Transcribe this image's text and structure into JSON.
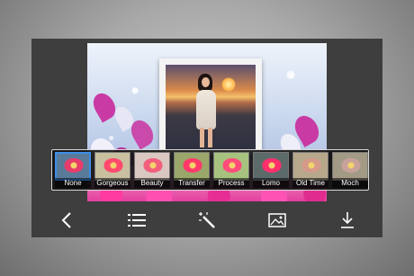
{
  "filters": [
    {
      "label": "None",
      "selected": true,
      "tint": "#5a7a9a",
      "petal": "#e83c6a"
    },
    {
      "label": "Gorgeous",
      "selected": false,
      "tint": "#c9c0a0",
      "petal": "#ff4a6e"
    },
    {
      "label": "Beauty",
      "selected": false,
      "tint": "#d9c7c2",
      "petal": "#f25f7c"
    },
    {
      "label": "Transfer",
      "selected": false,
      "tint": "#9aa76a",
      "petal": "#ff3a6a"
    },
    {
      "label": "Process",
      "selected": false,
      "tint": "#a7c27f",
      "petal": "#ff4c7a"
    },
    {
      "label": "Lomo",
      "selected": false,
      "tint": "#5d6a6a",
      "petal": "#ff2f6c"
    },
    {
      "label": "Old Time",
      "selected": false,
      "tint": "#b7a88c",
      "petal": "#d59a8a"
    },
    {
      "label": "Moch",
      "selected": false,
      "tint": "#a39a85",
      "petal": "#c8a29a"
    }
  ],
  "toolbar": {
    "back_icon": "chevron-left-icon",
    "menu_icon": "list-icon",
    "effects_icon": "magic-wand-icon",
    "gallery_icon": "image-icon",
    "download_icon": "download-icon"
  },
  "colors": {
    "app_bg": "#3e3e3e",
    "selected_outline": "#3c8ee8"
  }
}
